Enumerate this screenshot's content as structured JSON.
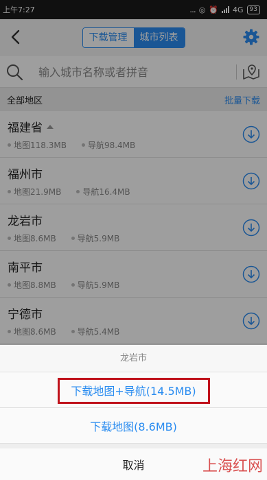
{
  "status_bar": {
    "time": "上午7:27",
    "dots": "...",
    "network": "4G",
    "battery": "93"
  },
  "header": {
    "tabs": [
      {
        "label": "下载管理",
        "active": false
      },
      {
        "label": "城市列表",
        "active": true
      }
    ]
  },
  "search": {
    "placeholder": "输入城市名称或者拼音"
  },
  "section": {
    "title": "全部地区",
    "action": "批量下载"
  },
  "cities": [
    {
      "name": "福建省",
      "map": "地图118.3MB",
      "nav": "导航98.4MB",
      "expandable": true
    },
    {
      "name": "福州市",
      "map": "地图21.9MB",
      "nav": "导航16.4MB"
    },
    {
      "name": "龙岩市",
      "map": "地图8.6MB",
      "nav": "导航5.9MB"
    },
    {
      "name": "南平市",
      "map": "地图8.8MB",
      "nav": "导航5.9MB"
    },
    {
      "name": "宁德市",
      "map": "地图8.6MB",
      "nav": "导航5.4MB"
    }
  ],
  "sheet": {
    "title": "龙岩市",
    "options": [
      "下载地图+导航(14.5MB)",
      "下载地图(8.6MB)"
    ],
    "cancel": "取消"
  },
  "watermark": "上海红网",
  "colors": {
    "accent": "#2a8cf0",
    "highlight_border": "#c0121b"
  }
}
